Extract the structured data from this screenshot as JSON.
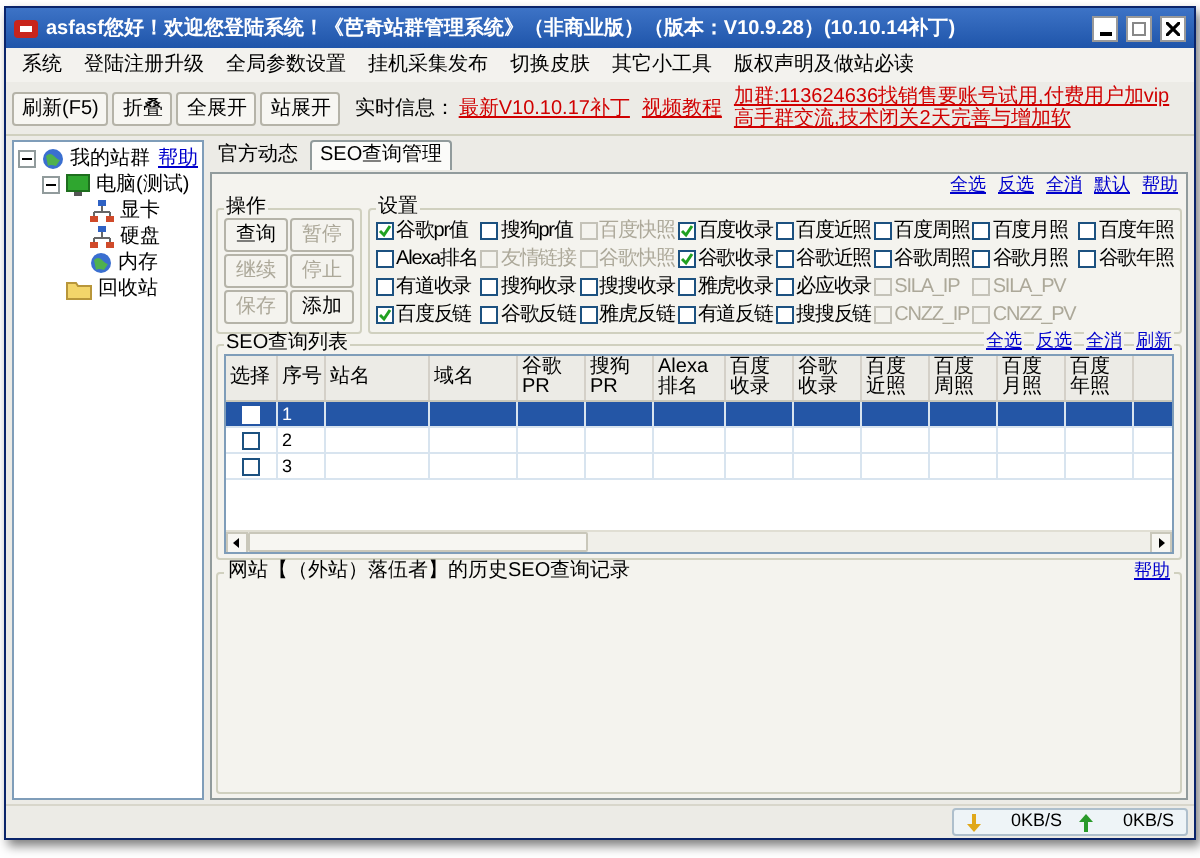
{
  "window": {
    "title": "asfasf您好！欢迎您登陆系统！《芭奇站群管理系统》（非商业版）（版本：V10.9.28）(10.10.14补丁)"
  },
  "menu": [
    "系统",
    "登陆注册升级",
    "全局参数设置",
    "挂机采集发布",
    "切换皮肤",
    "其它小工具",
    "版权声明及做站必读"
  ],
  "toolbar": {
    "buttons": [
      "刷新(F5)",
      "折叠",
      "全展开",
      "站展开"
    ],
    "info_label": "实时信息：",
    "links": [
      "最新V10.10.17补丁",
      "视频教程"
    ],
    "notice": "加群:113624636找销售要账号试用,付费用户加vip高手群交流,技术闭关2天完善与增加软"
  },
  "sidebar": {
    "help": "帮助",
    "tree": [
      {
        "label": "我的站群",
        "kind": "globe",
        "expanded": true,
        "children": [
          {
            "label": "电脑(测试)",
            "kind": "monitor",
            "expanded": true,
            "children": [
              {
                "label": "显卡",
                "kind": "network"
              },
              {
                "label": "硬盘",
                "kind": "network"
              },
              {
                "label": "内存",
                "kind": "globe"
              }
            ]
          },
          {
            "label": "回收站",
            "kind": "folder"
          }
        ]
      }
    ]
  },
  "tabs": [
    {
      "label": "官方动态",
      "selected": false
    },
    {
      "label": "SEO查询管理",
      "selected": true
    }
  ],
  "settings_links": [
    "全选",
    "反选",
    "全消",
    "默认",
    "帮助"
  ],
  "operations": {
    "title": "操作",
    "buttons": [
      {
        "label": "查询",
        "disabled": false
      },
      {
        "label": "暂停",
        "disabled": true
      },
      {
        "label": "继续",
        "disabled": true
      },
      {
        "label": "停止",
        "disabled": true
      },
      {
        "label": "保存",
        "disabled": true
      },
      {
        "label": "添加",
        "disabled": false
      }
    ]
  },
  "settings": {
    "title": "设置",
    "rows": [
      [
        {
          "label": "谷歌pr值",
          "checked": true,
          "disabled": false
        },
        {
          "label": "搜狗pr值",
          "checked": false,
          "disabled": false
        },
        {
          "label": "百度快照",
          "checked": false,
          "disabled": true
        },
        {
          "label": "百度收录",
          "checked": true,
          "disabled": false
        },
        {
          "label": "百度近照",
          "checked": false,
          "disabled": false
        },
        {
          "label": "百度周照",
          "checked": false,
          "disabled": false
        },
        {
          "label": "百度月照",
          "checked": false,
          "disabled": false
        },
        {
          "label": "百度年照",
          "checked": false,
          "disabled": false
        }
      ],
      [
        {
          "label": "Alexa排名",
          "checked": false,
          "disabled": false
        },
        {
          "label": "友情链接",
          "checked": false,
          "disabled": true
        },
        {
          "label": "谷歌快照",
          "checked": false,
          "disabled": true
        },
        {
          "label": "谷歌收录",
          "checked": true,
          "disabled": false
        },
        {
          "label": "谷歌近照",
          "checked": false,
          "disabled": false
        },
        {
          "label": "谷歌周照",
          "checked": false,
          "disabled": false
        },
        {
          "label": "谷歌月照",
          "checked": false,
          "disabled": false
        },
        {
          "label": "谷歌年照",
          "checked": false,
          "disabled": false
        }
      ],
      [
        {
          "label": "有道收录",
          "checked": false,
          "disabled": false
        },
        {
          "label": "搜狗收录",
          "checked": false,
          "disabled": false
        },
        {
          "label": "搜搜收录",
          "checked": false,
          "disabled": false
        },
        {
          "label": "雅虎收录",
          "checked": false,
          "disabled": false
        },
        {
          "label": "必应收录",
          "checked": false,
          "disabled": false
        },
        {
          "label": "SILA_IP",
          "checked": false,
          "disabled": true
        },
        {
          "label": "SILA_PV",
          "checked": false,
          "disabled": true
        }
      ],
      [
        {
          "label": "百度反链",
          "checked": true,
          "disabled": false
        },
        {
          "label": "谷歌反链",
          "checked": false,
          "disabled": false
        },
        {
          "label": "雅虎反链",
          "checked": false,
          "disabled": false
        },
        {
          "label": "有道反链",
          "checked": false,
          "disabled": false
        },
        {
          "label": "搜搜反链",
          "checked": false,
          "disabled": false
        },
        {
          "label": "CNZZ_IP",
          "checked": false,
          "disabled": true
        },
        {
          "label": "CNZZ_PV",
          "checked": false,
          "disabled": true
        }
      ]
    ]
  },
  "seo_list": {
    "title": "SEO查询列表",
    "links": [
      "全选",
      "反选",
      "全消",
      "刷新"
    ],
    "columns": [
      "选择",
      "序号",
      "站名",
      "域名",
      "谷歌PR",
      "搜狗PR",
      "Alexa排名",
      "百度收录",
      "谷歌收录",
      "百度近照",
      "百度周照",
      "百度月照",
      "百度年照"
    ],
    "rows": [
      {
        "index": "1",
        "checked": false,
        "selected": true
      },
      {
        "index": "2",
        "checked": false,
        "selected": false
      },
      {
        "index": "3",
        "checked": false,
        "selected": false
      }
    ]
  },
  "history": {
    "title": "网站【（外站）落伍者】的历史SEO查询记录",
    "help": "帮助"
  },
  "status_bar": {
    "download": "0KB/S",
    "upload": "0KB/S"
  }
}
